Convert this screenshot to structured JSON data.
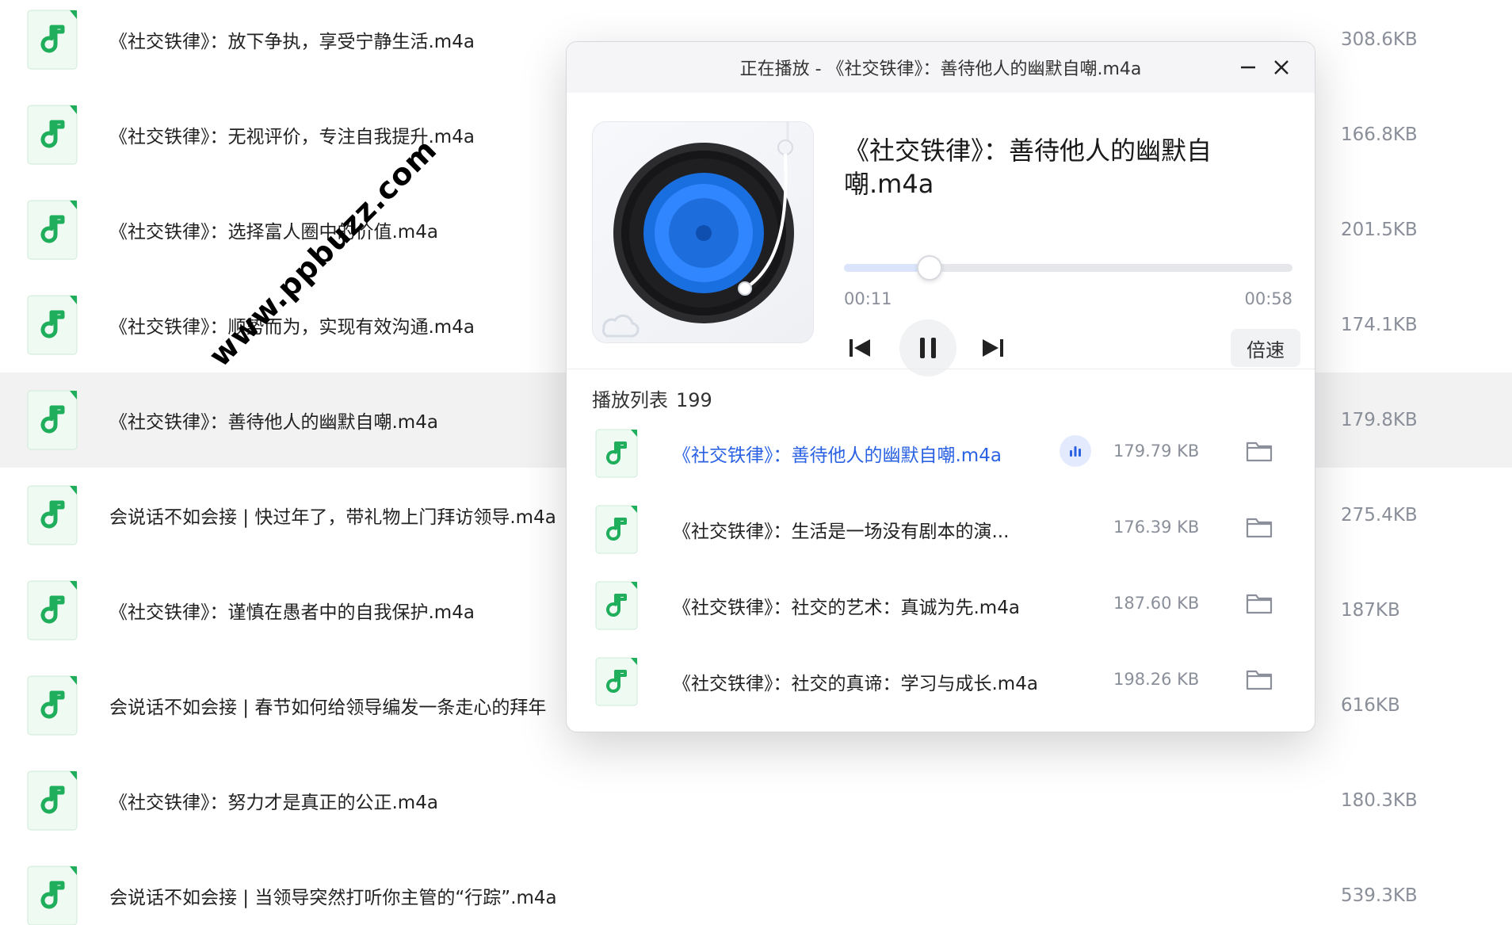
{
  "files": [
    {
      "name": "《社交铁律》：放下争执，享受宁静生活.m4a",
      "size": "308.6KB"
    },
    {
      "name": "《社交铁律》：无视评价，专注自我提升.m4a",
      "size": "166.8KB"
    },
    {
      "name": "《社交铁律》：选择富人圈中的价值.m4a",
      "size": "201.5KB"
    },
    {
      "name": "《社交铁律》：顺势而为，实现有效沟通.m4a",
      "size": "174.1KB"
    },
    {
      "name": "《社交铁律》：善待他人的幽默自嘲.m4a",
      "size": "179.8KB",
      "selected": true
    },
    {
      "name": "会说话不如会接 | 快过年了，带礼物上门拜访领导.m4a",
      "size": "275.4KB"
    },
    {
      "name": "《社交铁律》：谨慎在愚者中的自我保护.m4a",
      "size": "187KB"
    },
    {
      "name": "会说话不如会接 | 春节如何给领导编发一条走心的拜年",
      "size": "616KB"
    },
    {
      "name": "《社交铁律》：努力才是真正的公正.m4a",
      "size": "180.3KB"
    },
    {
      "name": "会说话不如会接 | 当领导突然打听你主管的“行踪”.m4a",
      "size": "539.3KB"
    }
  ],
  "watermark": "www.ppbuzz.com",
  "player": {
    "window_title": "正在播放 - 《社交铁律》：善待他人的幽默自嘲.m4a",
    "song_title": "《社交铁律》：善待他人的幽默自嘲.m4a",
    "current_time": "00:11",
    "duration": "00:58",
    "progress": 0.19,
    "speed_label": "倍速",
    "playlist_label": "播放列表",
    "playlist_count": "199",
    "playlist": [
      {
        "name": "《社交铁律》：善待他人的幽默自嘲.m4a",
        "size": "179.79 KB",
        "active": true
      },
      {
        "name": "《社交铁律》：生活是一场没有剧本的演...",
        "size": "176.39 KB"
      },
      {
        "name": "《社交铁律》：社交的艺术：真诚为先.m4a",
        "size": "187.60 KB"
      },
      {
        "name": "《社交铁律》：社交的真谛：学习与成长.m4a",
        "size": "198.26 KB"
      }
    ]
  },
  "colors": {
    "accent": "#2a62e3",
    "icon_green": "#1fae5b",
    "selected_row": "#f2f2f3"
  },
  "icons": [
    "music-note-icon",
    "minimize-icon",
    "close-icon",
    "previous-icon",
    "pause-icon",
    "next-icon",
    "playing-indicator-icon",
    "folder-icon",
    "vinyl-record-icon"
  ]
}
